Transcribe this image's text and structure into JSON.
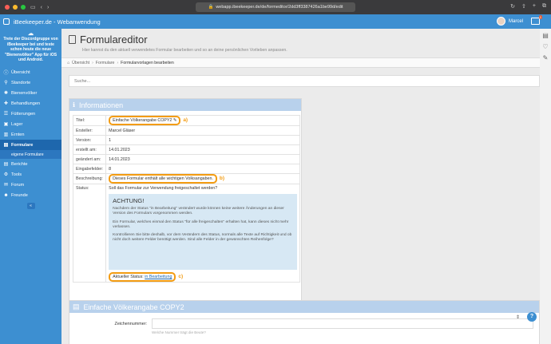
{
  "browser": {
    "url": "webapp.ibeekeeper.de/de/formeditor/2dd3ff3387426a1be99d/edit",
    "icons": [
      "sidebar-toggle-icon",
      "back-icon",
      "forward-icon",
      "lock-icon",
      "reload-icon",
      "share-icon",
      "new-tab-icon",
      "tabs-icon"
    ]
  },
  "app": {
    "title": "iBeekeeper.de - Webanwendung",
    "user": "Marcel",
    "notifications": "1",
    "accent": "#3d8fd1"
  },
  "sidebar": {
    "discord_text": "Trete der Discordgruppe von iBeekeeper bei und teste schon heute die neue \"Bienenvölker\" App für iOS und Android.",
    "items": [
      {
        "label": "Übersicht",
        "icon": "info"
      },
      {
        "label": "Standorte",
        "icon": "pin"
      },
      {
        "label": "Bienenvölker",
        "icon": "cog"
      },
      {
        "label": "Behandlungen",
        "icon": "pill"
      },
      {
        "label": "Fütterungen",
        "icon": "bars"
      },
      {
        "label": "Lager",
        "icon": "truck"
      },
      {
        "label": "Ernten",
        "icon": "chart"
      },
      {
        "label": "Formulare",
        "icon": "doc"
      },
      {
        "label": "eigene Formulare",
        "icon": ""
      },
      {
        "label": "Berichte",
        "icon": "doc"
      },
      {
        "label": "Tools",
        "icon": "gear"
      },
      {
        "label": "Forum",
        "icon": "chat"
      },
      {
        "label": "Freunde",
        "icon": "users"
      }
    ]
  },
  "main": {
    "title": "Formulareditor",
    "subtitle": "Hier kannst du den aktuell verwendetes Formular bearbeiten und so an deine persönlichen Vorlieben anpassen.",
    "breadcrumb": [
      "Übersicht",
      "Formulare",
      "Formularvorlagen bearbeiten"
    ],
    "search_placeholder": "Suche...",
    "info_title": "Informationen",
    "rows": {
      "titel": {
        "label": "Titel:",
        "value": "Einfache Völkerangabe COPY2",
        "annot": "a)"
      },
      "ersteller": {
        "label": "Ersteller:",
        "value": "Marcel Gläser"
      },
      "version": {
        "label": "Version:",
        "value": "1"
      },
      "erstellt": {
        "label": "erstellt am:",
        "value": "14.01.2023"
      },
      "geaendert": {
        "label": "geändert am:",
        "value": "14.01.2023"
      },
      "felder": {
        "label": "Eingabefelder:",
        "value": "8"
      },
      "beschreibung": {
        "label": "Beschreibung:",
        "value": "Dieses Formular enthält alle wichtigen Volksangaben.",
        "annot": "b)"
      },
      "status": {
        "label": "Status:",
        "question": "Soll das Formular zur Verwendung freigeschaltet werden?",
        "warn_title": "ACHTUNG!",
        "warn_p1": "Nachdem der Status \"in Bearbeitung\" verändert wurde können keine weitere Änderungen an dieser Version des Formulars vorgenommen werden.",
        "warn_p2": "Ein Formular, welches einmal den Status \"für alle freigeschalten\" erhalten hat, kann dieses nicht mehr verlassen.",
        "warn_p3": "Kontrollieren Sie bitte deshalb, vor dem Verändern des Status, normals alle Texte auf Richtigkeit und ob nicht doch weitere Felder benötigt werden. Sind alle Felder in der gewünschten Reihenfolge?",
        "current_label": "Aktueller Status:",
        "current_value": "in Bearbeitung",
        "annot": "c)"
      }
    },
    "section2_title": "Einfache Völkerangabe COPY2",
    "field_label": "Zeichennummer:",
    "field_hint": "Welche Nummer trägt die Beute?",
    "help": "?"
  }
}
